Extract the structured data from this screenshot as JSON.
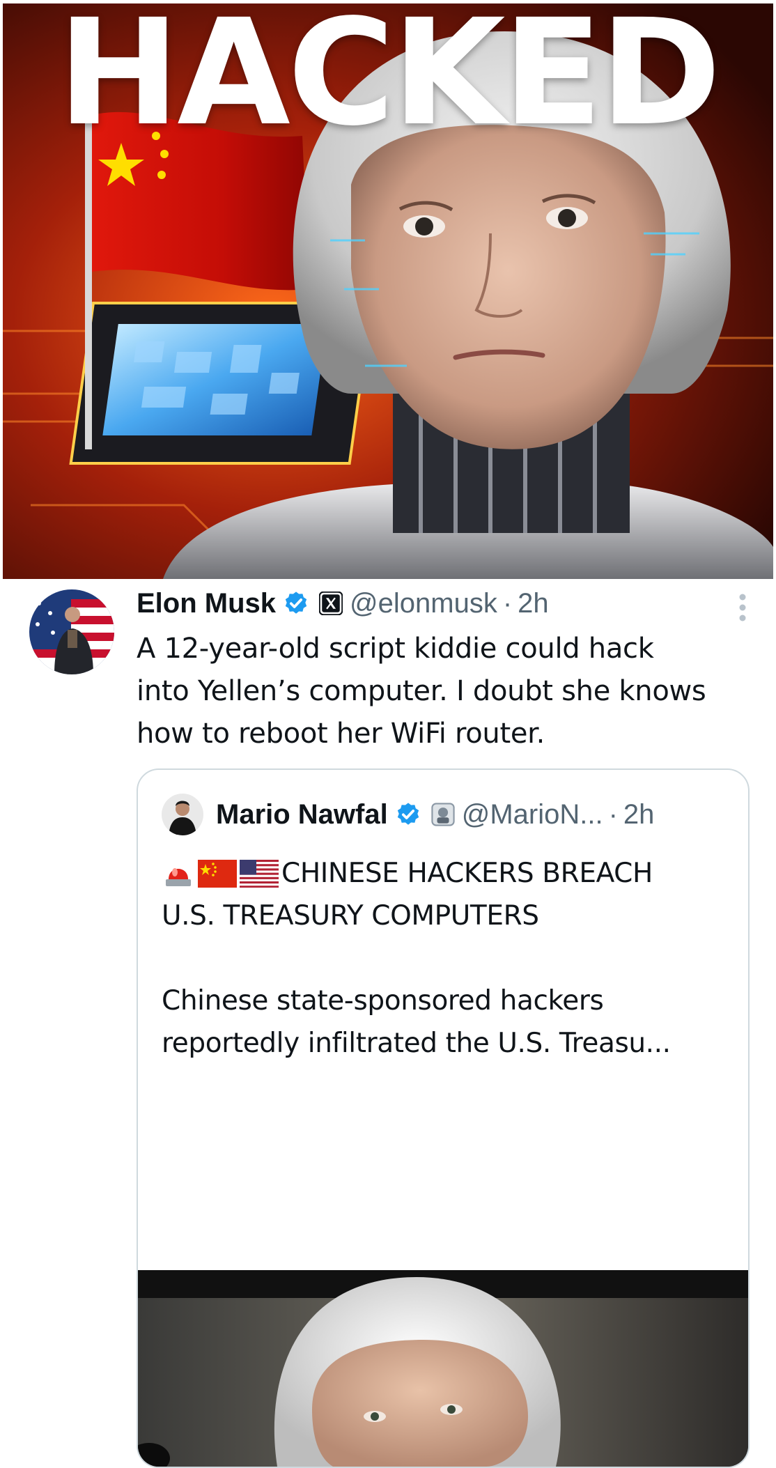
{
  "hero": {
    "overlay_text": "HACKED"
  },
  "tweet": {
    "author_name": "Elon Musk",
    "author_handle": "@elonmusk",
    "separator": "·",
    "time": "2h",
    "text_lines": [
      "A 12-year-old script kiddie could hack",
      "into Yellen’s computer. I doubt she knows",
      "how to reboot her WiFi router."
    ],
    "icons": {
      "verified": "verified-badge-icon",
      "affiliation": "x-logo-icon",
      "more": "more-options-icon"
    }
  },
  "quote": {
    "author_name": "Mario Nawfal",
    "author_handle": "@MarioN...",
    "separator": "·",
    "time": "2h",
    "headline_line1": "CHINESE HACKERS BREACH",
    "headline_line2": "U.S. TREASURY COMPUTERS",
    "body_lines": [
      "Chinese state-sponsored hackers",
      "reportedly infiltrated the U.S. Treasu..."
    ],
    "emojis": [
      "police-light-icon",
      "china-flag-icon",
      "us-flag-icon"
    ]
  },
  "colors": {
    "text_primary": "#0f1419",
    "text_secondary": "#536471",
    "verified_blue": "#1d9bf0",
    "border": "#cfd9de"
  }
}
